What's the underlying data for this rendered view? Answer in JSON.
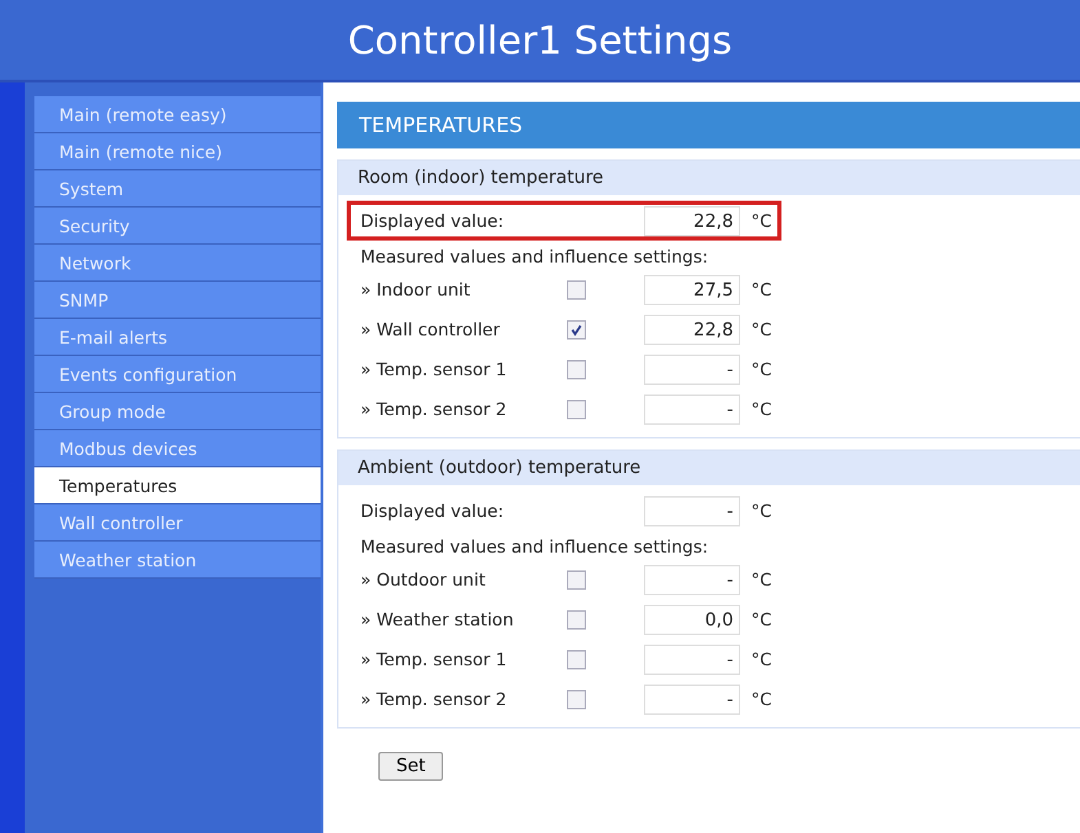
{
  "page_title": "Controller1 Settings",
  "sidebar": {
    "items": [
      {
        "label": "Main (remote easy)",
        "selected": false
      },
      {
        "label": "Main (remote nice)",
        "selected": false
      },
      {
        "label": "System",
        "selected": false
      },
      {
        "label": "Security",
        "selected": false
      },
      {
        "label": "Network",
        "selected": false
      },
      {
        "label": "SNMP",
        "selected": false
      },
      {
        "label": "E-mail alerts",
        "selected": false
      },
      {
        "label": "Events configuration",
        "selected": false
      },
      {
        "label": "Group mode",
        "selected": false
      },
      {
        "label": "Modbus devices",
        "selected": false
      },
      {
        "label": "Temperatures",
        "selected": true
      },
      {
        "label": "Wall controller",
        "selected": false
      },
      {
        "label": "Weather station",
        "selected": false
      }
    ]
  },
  "panel_title": "TEMPERATURES",
  "sections": [
    {
      "title": "Room (indoor) temperature",
      "displayed": {
        "label": "Displayed value:",
        "value": "22,8",
        "unit": "°C",
        "highlighted": true
      },
      "measured_label": "Measured values and influence settings:",
      "rows": [
        {
          "label": "» Indoor unit",
          "checked": false,
          "value": "27,5",
          "unit": "°C"
        },
        {
          "label": "» Wall controller",
          "checked": true,
          "value": "22,8",
          "unit": "°C"
        },
        {
          "label": "» Temp. sensor 1",
          "checked": false,
          "value": "-",
          "unit": "°C"
        },
        {
          "label": "» Temp. sensor 2",
          "checked": false,
          "value": "-",
          "unit": "°C"
        }
      ]
    },
    {
      "title": "Ambient (outdoor) temperature",
      "displayed": {
        "label": "Displayed value:",
        "value": "-",
        "unit": "°C"
      },
      "measured_label": "Measured values and influence settings:",
      "rows": [
        {
          "label": "» Outdoor unit",
          "checked": false,
          "value": "-",
          "unit": "°C"
        },
        {
          "label": "» Weather station",
          "checked": false,
          "value": "0,0",
          "unit": "°C"
        },
        {
          "label": "» Temp. sensor 1",
          "checked": false,
          "value": "-",
          "unit": "°C"
        },
        {
          "label": "» Temp. sensor 2",
          "checked": false,
          "value": "-",
          "unit": "°C"
        }
      ]
    }
  ],
  "button": "Set"
}
